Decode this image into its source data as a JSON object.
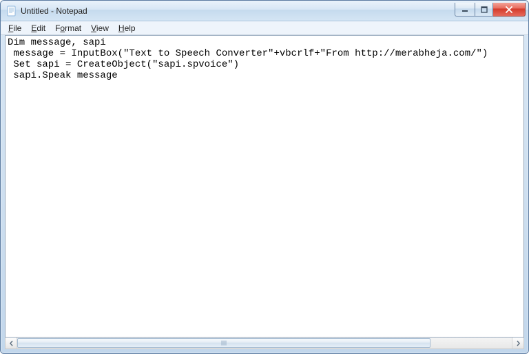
{
  "window": {
    "title": "Untitled - Notepad"
  },
  "menu": {
    "file": "File",
    "edit": "Edit",
    "format": "Format",
    "view": "View",
    "help": "Help"
  },
  "editor": {
    "content": "Dim message, sapi\n message = InputBox(\"Text to Speech Converter\"+vbcrlf+\"From http://merabheja.com/\")\n Set sapi = CreateObject(\"sapi.spvoice\")\n sapi.Speak message"
  }
}
